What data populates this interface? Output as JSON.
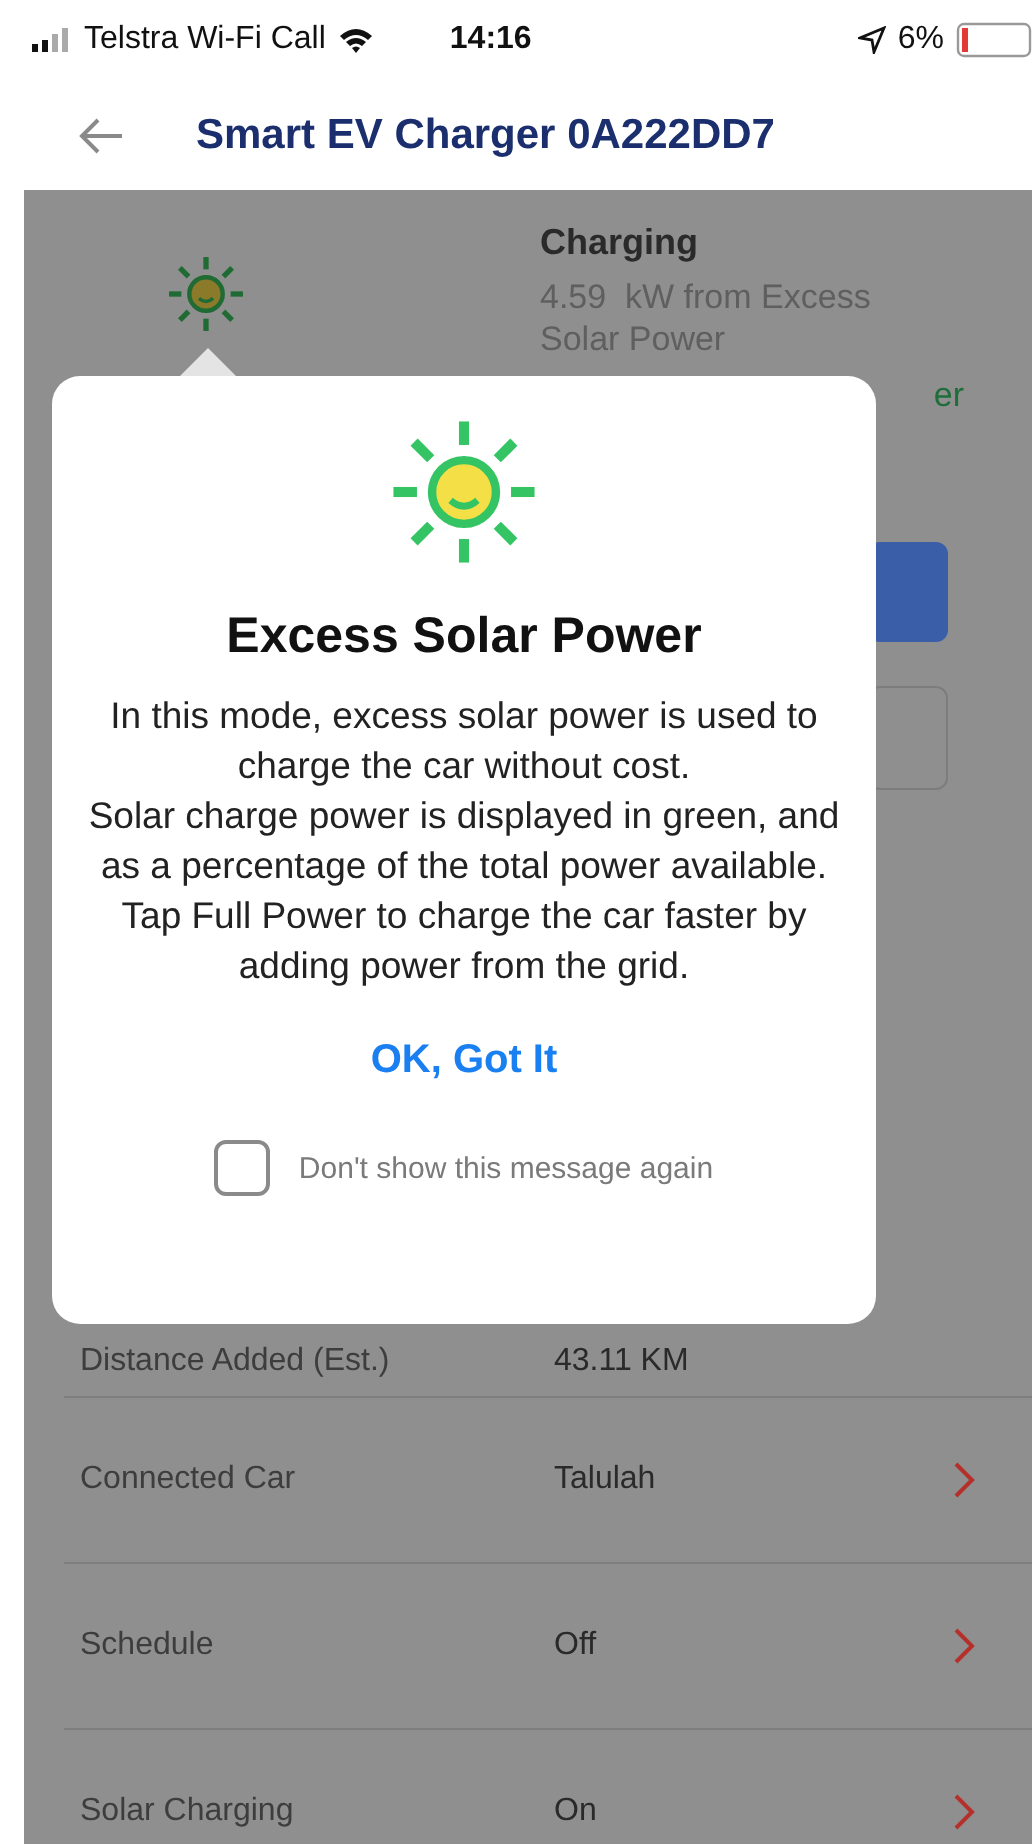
{
  "status_bar": {
    "carrier": "Telstra Wi-Fi Call",
    "time": "14:16",
    "battery": "6%"
  },
  "nav": {
    "title": "Smart EV Charger 0A222DD7"
  },
  "charger": {
    "status": "Charging",
    "detail": "4.59  kW from Excess Solar Power",
    "hidden_fragment": "er"
  },
  "dialog": {
    "title": "Excess Solar Power",
    "body": [
      "In this mode, excess solar power is used to charge the car without cost.",
      "Solar charge power is displayed in green, and as a percentage of the total power available.",
      "Tap Full Power to charge the car faster by adding power from the grid."
    ],
    "button": "OK, Got It",
    "checkbox": {
      "label": "Don't show this message again",
      "checked": false
    }
  },
  "details": [
    {
      "label": "Distance Added (Est.)",
      "value": "43.11 KM",
      "chevron": false
    },
    {
      "label": "Connected Car",
      "value": "Talulah",
      "chevron": true
    },
    {
      "label": "Schedule",
      "value": "Off",
      "chevron": true
    },
    {
      "label": "Solar Charging",
      "value": "On",
      "chevron": true
    }
  ]
}
